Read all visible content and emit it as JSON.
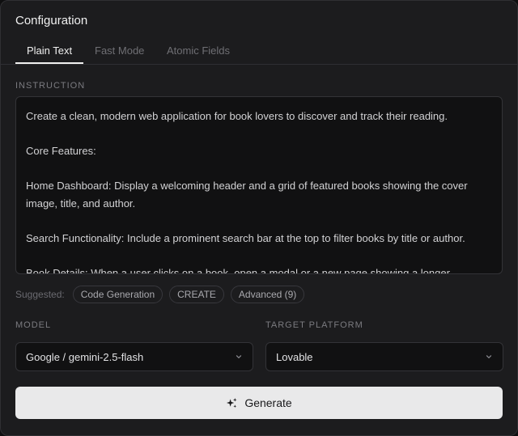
{
  "header": {
    "title": "Configuration"
  },
  "tabs": [
    {
      "label": "Plain Text",
      "active": true
    },
    {
      "label": "Fast Mode",
      "active": false
    },
    {
      "label": "Atomic Fields",
      "active": false
    }
  ],
  "instruction": {
    "label": "INSTRUCTION",
    "value": "Create a clean, modern web application for book lovers to discover and track their reading.\n\nCore Features:\n\nHome Dashboard: Display a welcoming header and a grid of featured books showing the cover image, title, and author.\n\nSearch Functionality: Include a prominent search bar at the top to filter books by title or author.\n\nBook Details: When a user clicks on a book, open a modal or a new page showing a longer"
  },
  "suggested": {
    "label": "Suggested:",
    "chips": [
      "Code Generation",
      "CREATE",
      "Advanced (9)"
    ]
  },
  "model": {
    "label": "MODEL",
    "value": "Google / gemini-2.5-flash"
  },
  "target_platform": {
    "label": "TARGET PLATFORM",
    "value": "Lovable"
  },
  "generate": {
    "label": "Generate"
  },
  "icons": {
    "select_arrow": "chevron-down-icon",
    "generate": "sparkles-icon"
  },
  "colors": {
    "panel_bg": "#1c1c1e",
    "page_bg": "#0f0f10",
    "button_bg": "#e9e9ea",
    "active_tab": "#f0f0f0",
    "inactive_tab": "#6f6f74"
  }
}
